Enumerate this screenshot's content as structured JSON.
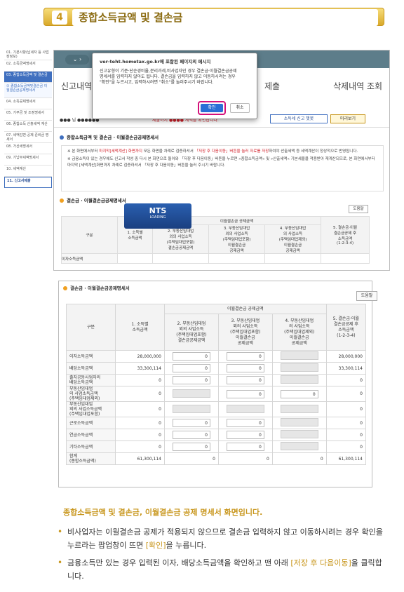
{
  "banner": {
    "num": "4",
    "title": "종합소득금액 및 결손금"
  },
  "nav": [
    {
      "label": "01. 기본사항(납세자 등 사업장정보)",
      "type": "item"
    },
    {
      "label": "02. 소득금액명세서",
      "type": "item"
    },
    {
      "label": "03. 종합소득금액 및 결손금",
      "type": "sel"
    },
    {
      "label": "① 종합소득금액및결손금 이월결손금공제명세서",
      "type": "sub"
    },
    {
      "label": "04. 소득공제명세서",
      "type": "item"
    },
    {
      "label": "05. 기부금 및 조정명세서",
      "type": "item"
    },
    {
      "label": "06. 종합소득 산출세액 계산",
      "type": "item"
    },
    {
      "label": "07. 세액감면·공제 준비금 명세서",
      "type": "item"
    },
    {
      "label": "08. 가산세명세서",
      "type": "item"
    },
    {
      "label": "09. 기납부세액명세서",
      "type": "item"
    },
    {
      "label": "10. 세액계산",
      "type": "item"
    },
    {
      "label": "11. 신고서제출",
      "type": "last"
    }
  ],
  "shot1": {
    "tab_left": "신고내역",
    "tab_mid": "제출",
    "tab_right": "삭제내역 조회",
    "dialog": {
      "title": "ver-teht.hometax.go.kr에 포함된 페이지의 메시지",
      "body": "신고유형이 기준·단순경비율,분리과세,비사업자인 경우 결손금·이월결손금공제명세서를 입력하지 않아도 됩니다. 결손금을 입력하지 않고 이동하시려는 경우 \"확인\"을 누르시고, 입력하시려면 \"취소\"를 눌러주시기 바랍니다.",
      "ok": "확인",
      "cancel": "취소"
    },
    "row_text": "●●● 님 ●●●●●●",
    "row_warn": "제출하시 ●●●● 세액을 확인합니다.",
    "btn_chat": "소득세 신고 챗봇",
    "btn_preview": "미리보기",
    "section": "종합소득금액 및 결손금 · 이월결손금공제명세서",
    "note1a": "※ 본 화면에서부터 ",
    "note1b": "마지막[세액계산] 화면까지",
    "note1c": " 모든 화면을 차례로 검증하셔서 ",
    "note1d": "「저장 후 다음이동」버튼을 눌러 자료를 저장",
    "note1e": "하여야 산출세액 등 세액계산이 정상적으로 반영됩니다.",
    "note2": "※ 금융소득이 있는 경우에도 신고서 작성 중 다시 본 화면으로 돌아와 「저장 후 다음이동」버튼을 누르면 »종합소득금액« 및 »산출세액« 기본세율을 적용받아 재계산되므로, 본 화면에서부터 마지막 [세액계산]화면까지 차례로 검증하셔서 「저장 후 다음이동」버튼을 눌러 주시기 바랍니다.",
    "section2": "결손금 · 이월결손금공제명세서",
    "loading_title": "NTS",
    "loading_sub": "LOADING",
    "help": "도움말",
    "row_label": "이자소득금액"
  },
  "shot2": {
    "section": "결손금 · 이월결손금공제명세서",
    "help": "도움말",
    "group_header": "이월결손금 공제금액",
    "headers": [
      "구분",
      "1. 소득별\n소득금액",
      "2. 부동산임대업\n외의 사업소득\n(주택임대업포함)\n결손금공제금액",
      "3. 부동산임대업\n외의 사업소득\n(주택임대업포함)\n이월결손금\n공제금액",
      "4. 부동산임대업\n의 사업소득\n(주택임대업제외)\n이월결손금\n공제금액",
      "5. 결손금·이월\n결손금공제 후\n소득금액\n(1-2-3-4)"
    ],
    "rows": [
      {
        "label": "이자소득금액",
        "c1": "28,000,000",
        "c2": "0",
        "c3": "0",
        "c4": "",
        "c5": "28,000,000"
      },
      {
        "label": "배당소득금액",
        "c1": "33,300,114",
        "c2": "0",
        "c3": "0",
        "c4": "",
        "c5": "33,300,114"
      },
      {
        "label": "출자공동사업자의\n배당소득금액",
        "c1": "0",
        "c2": "0",
        "c3": "0",
        "c4": "",
        "c5": "0"
      },
      {
        "label": "부동산임대업\n의 사업소득금액\n(주택임대업제외)",
        "c1": "0",
        "c2": "",
        "c3": "0",
        "c4": "0",
        "c5": "0"
      },
      {
        "label": "부동산임대업\n외의 사업소득금액\n(주택임대업포함)",
        "c1": "0",
        "c2": "",
        "c3": "",
        "c4": "",
        "c5": "0"
      },
      {
        "label": "근로소득금액",
        "c1": "0",
        "c2": "0",
        "c3": "0",
        "c4": "",
        "c5": "0"
      },
      {
        "label": "연금소득금액",
        "c1": "0",
        "c2": "0",
        "c3": "0",
        "c4": "",
        "c5": "0"
      },
      {
        "label": "기타소득금액",
        "c1": "0",
        "c2": "0",
        "c3": "0",
        "c4": "",
        "c5": "0"
      },
      {
        "label": "합계\n(종합소득금액)",
        "c1": "61,300,114",
        "c2": "0",
        "c3": "0",
        "c4": "0",
        "c5": "61,300,114"
      }
    ]
  },
  "desc": {
    "heading": "종합소득금액 및 결손금, 이월결손금 공제 명세서 화면입니다.",
    "b1a": "비사업자는 이월결손금 공제가 적용되지 않으므로 결손금 입력하지 않고 이동하시려는 경우 확인을 누르라는 팝업창이 뜨면 ",
    "b1b": "[확인]",
    "b1c": "을 누릅니다.",
    "b2a": "금융소득만 있는 경우 입력된 이자, 배당소득금액을 확인하고 맨 아래 ",
    "b2b": "[저장 후 다음이동]",
    "b2c": "을 클릭합니다."
  },
  "colors": {
    "accent": "#c8961c",
    "blue": "#3f6fbf",
    "red": "#d2202a"
  }
}
